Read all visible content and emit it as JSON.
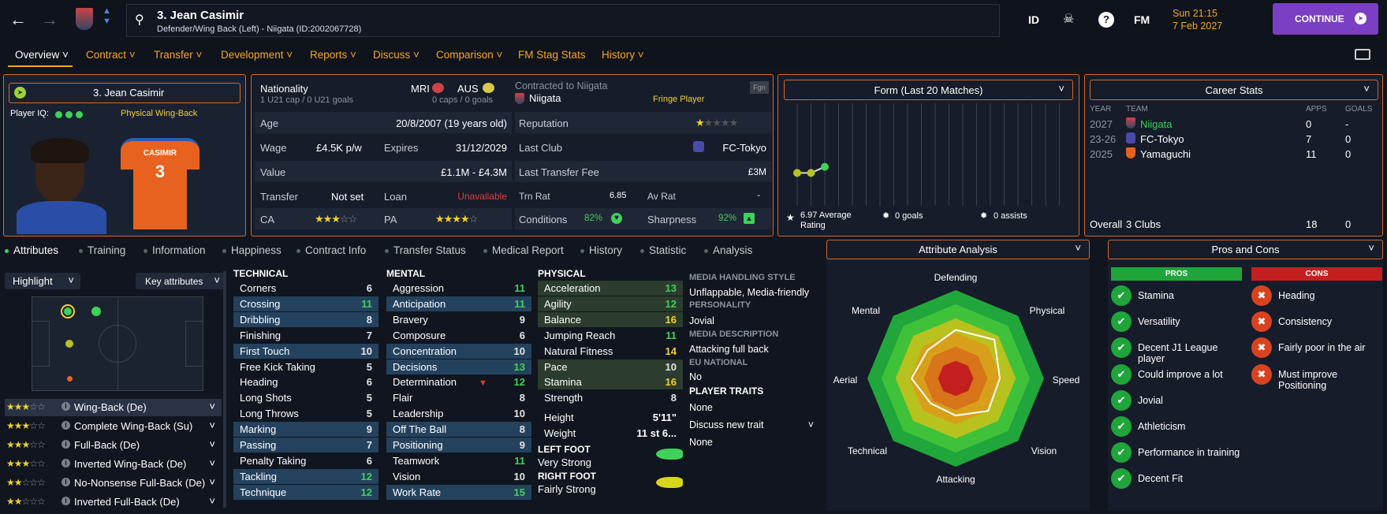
{
  "header": {
    "title": "3. Jean Casimir",
    "subtitle": "Defender/Wing Back (Left) - Niigata (ID:2002067728)",
    "id_label": "ID",
    "fm_label": "FM",
    "time": "Sun 21:15",
    "date": "7 Feb 2027",
    "continue_label": "CONTINUE"
  },
  "nav": [
    {
      "label": "Overview"
    },
    {
      "label": "Contract"
    },
    {
      "label": "Transfer"
    },
    {
      "label": "Development"
    },
    {
      "label": "Reports"
    },
    {
      "label": "Discuss"
    },
    {
      "label": "Comparison"
    },
    {
      "label": "FM Stag Stats"
    },
    {
      "label": "History"
    }
  ],
  "card": {
    "name": "3. Jean Casimir",
    "iq_label": "Player IQ:",
    "role": "Physical Wing-Back",
    "shirt_name": "CASIMIR",
    "shirt_number": "3"
  },
  "info": {
    "nationality_label": "Nationality",
    "nat1": "MRI",
    "nat2": "AUS",
    "u21": "1 U21 cap / 0 U21 goals",
    "caps": "0 caps / 0 goals",
    "age_label": "Age",
    "age": "20/8/2007 (19 years old)",
    "wage_label": "Wage",
    "wage": "£4.5K p/w",
    "expires_label": "Expires",
    "expires": "31/12/2029",
    "value_label": "Value",
    "value": "£1.1M - £4.3M",
    "transfer_label": "Transfer",
    "transfer": "Not set",
    "loan_label": "Loan",
    "loan": "Unavailable",
    "ca_label": "CA",
    "pa_label": "PA",
    "ca_stars": 2.5,
    "pa_stars": 3.5
  },
  "contract": {
    "contracted_label": "Contracted to Niigata",
    "club": "Niigata",
    "status": "Fringe Player",
    "fgn": "Fgn",
    "reputation_label": "Reputation",
    "reputation_stars": 0.5,
    "last_club_label": "Last Club",
    "last_club": "FC-Tokyo",
    "last_fee_label": "Last Transfer Fee",
    "last_fee": "£3M",
    "trn_label": "Trn Rat",
    "trn": "6.85",
    "av_label": "Av Rat",
    "av": "-",
    "conditions_label": "Conditions",
    "conditions": "82%",
    "sharpness_label": "Sharpness",
    "sharpness": "92%"
  },
  "form": {
    "title": "Form (Last 20 Matches)",
    "avg": "6.97 Average Rating",
    "goals": "0 goals",
    "assists": "0 assists",
    "ratings": [
      6.6,
      6.6,
      6.9
    ]
  },
  "career": {
    "title": "Career Stats",
    "headers": [
      "YEAR",
      "TEAM",
      "APPS",
      "GOALS"
    ],
    "rows": [
      {
        "year": "2027",
        "team": "Niigata",
        "apps": "0",
        "goals": "-"
      },
      {
        "year": "23-26",
        "team": "FC-Tokyo",
        "apps": "7",
        "goals": "0"
      },
      {
        "year": "2025",
        "team": "Yamaguchi",
        "apps": "11",
        "goals": "0"
      }
    ],
    "overall_label": "Overall",
    "overall_clubs": "3 Clubs",
    "overall_apps": "18",
    "overall_goals": "0"
  },
  "tabs": [
    {
      "label": "Attributes"
    },
    {
      "label": "Training"
    },
    {
      "label": "Information"
    },
    {
      "label": "Happiness"
    },
    {
      "label": "Contract Info"
    },
    {
      "label": "Transfer Status"
    },
    {
      "label": "Medical Report"
    },
    {
      "label": "History"
    },
    {
      "label": "Statistic"
    },
    {
      "label": "Analysis"
    }
  ],
  "controls": {
    "highlight": "Highlight",
    "key_attributes": "Key attributes"
  },
  "roles": [
    {
      "name": "Wing-Back (De)",
      "stars": 3
    },
    {
      "name": "Complete Wing-Back (Su)",
      "stars": 2.5
    },
    {
      "name": "Full-Back (De)",
      "stars": 2.5
    },
    {
      "name": "Inverted Wing-Back (De)",
      "stars": 2.5
    },
    {
      "name": "No-Nonsense Full-Back (De)",
      "stars": 2
    },
    {
      "name": "Inverted Full-Back (De)",
      "stars": 2
    }
  ],
  "technical": {
    "title": "TECHNICAL",
    "items": [
      {
        "n": "Corners",
        "v": "6"
      },
      {
        "n": "Crossing",
        "v": "11"
      },
      {
        "n": "Dribbling",
        "v": "8"
      },
      {
        "n": "Finishing",
        "v": "7"
      },
      {
        "n": "First Touch",
        "v": "10"
      },
      {
        "n": "Free Kick Taking",
        "v": "5"
      },
      {
        "n": "Heading",
        "v": "6"
      },
      {
        "n": "Long Shots",
        "v": "5"
      },
      {
        "n": "Long Throws",
        "v": "5"
      },
      {
        "n": "Marking",
        "v": "9"
      },
      {
        "n": "Passing",
        "v": "7"
      },
      {
        "n": "Penalty Taking",
        "v": "6"
      },
      {
        "n": "Tackling",
        "v": "12"
      },
      {
        "n": "Technique",
        "v": "12"
      }
    ]
  },
  "mental": {
    "title": "MENTAL",
    "items": [
      {
        "n": "Aggression",
        "v": "11"
      },
      {
        "n": "Anticipation",
        "v": "11"
      },
      {
        "n": "Bravery",
        "v": "9"
      },
      {
        "n": "Composure",
        "v": "6"
      },
      {
        "n": "Concentration",
        "v": "10"
      },
      {
        "n": "Decisions",
        "v": "13"
      },
      {
        "n": "Determination",
        "v": "12"
      },
      {
        "n": "Flair",
        "v": "8"
      },
      {
        "n": "Leadership",
        "v": "10"
      },
      {
        "n": "Off The Ball",
        "v": "8"
      },
      {
        "n": "Positioning",
        "v": "9"
      },
      {
        "n": "Teamwork",
        "v": "11"
      },
      {
        "n": "Vision",
        "v": "10"
      },
      {
        "n": "Work Rate",
        "v": "15"
      }
    ]
  },
  "physical": {
    "title": "PHYSICAL",
    "items": [
      {
        "n": "Acceleration",
        "v": "13"
      },
      {
        "n": "Agility",
        "v": "12"
      },
      {
        "n": "Balance",
        "v": "16"
      },
      {
        "n": "Jumping Reach",
        "v": "11"
      },
      {
        "n": "Natural Fitness",
        "v": "14"
      },
      {
        "n": "Pace",
        "v": "10"
      },
      {
        "n": "Stamina",
        "v": "16"
      },
      {
        "n": "Strength",
        "v": "8"
      }
    ],
    "height_label": "Height",
    "height": "5'11\"",
    "weight_label": "Weight",
    "weight": "11 st 6...",
    "left_foot_label": "LEFT FOOT",
    "left_foot": "Very Strong",
    "right_foot_label": "RIGHT FOOT",
    "right_foot": "Fairly Strong"
  },
  "personality": {
    "media_style_label": "MEDIA HANDLING STYLE",
    "media_style": "Unflappable, Media-friendly",
    "personality_label": "PERSONALITY",
    "personality": "Jovial",
    "media_desc_label": "MEDIA DESCRIPTION",
    "media_desc": "Attacking full back",
    "eu_label": "EU NATIONAL",
    "eu": "No",
    "traits_label": "PLAYER TRAITS",
    "traits": "None",
    "discuss_label": "Discuss new trait",
    "discuss_value": "None"
  },
  "analysis": {
    "title": "Attribute Analysis",
    "labels": [
      "Defending",
      "Physical",
      "Speed",
      "Vision",
      "Attacking",
      "Technical",
      "Aerial",
      "Mental"
    ],
    "values": [
      0.55,
      0.62,
      0.5,
      0.52,
      0.42,
      0.4,
      0.5,
      0.45
    ]
  },
  "proscons": {
    "title": "Pros and Cons",
    "pros_label": "PROS",
    "cons_label": "CONS",
    "pros": [
      "Stamina",
      "Versatility",
      "Decent J1 League player",
      "Could improve a lot",
      "Jovial",
      "Athleticism",
      "Performance in training",
      "Decent Fit"
    ],
    "cons": [
      "Heading",
      "Consistency",
      "Fairly poor in the air",
      "Must improve Positioning"
    ]
  }
}
